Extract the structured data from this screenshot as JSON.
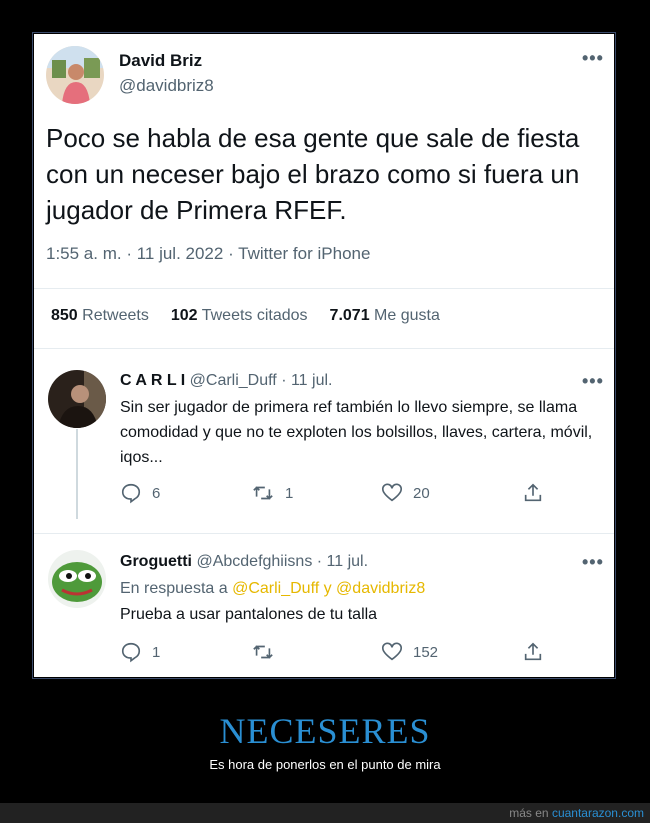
{
  "tweet": {
    "author_name": "David Briz",
    "author_handle": "@davidbriz8",
    "text": "Poco se habla de esa gente que sale de fiesta con un neceser bajo el brazo como si fuera un jugador de Primera RFEF.",
    "time": "1:55 a. m. · 11 jul. 2022 · Twitter for iPhone",
    "stats": {
      "retweets_count": "850",
      "retweets_label": "Retweets",
      "quotes_count": "102",
      "quotes_label": "Tweets citados",
      "likes_count": "7.071",
      "likes_label": "Me gusta"
    }
  },
  "replies": [
    {
      "name": "C A R L I",
      "handle": "@Carli_Duff",
      "date": "· 11 jul.",
      "text": "Sin ser jugador de primera ref también lo llevo siempre, se llama comodidad y que no te exploten los bolsillos, llaves, cartera, móvil, iqos...",
      "replies_count": "6",
      "retweets_count": "1",
      "likes_count": "20"
    },
    {
      "name": "Groguetti",
      "handle": "@Abcdefghiisns",
      "date": "· 11 jul.",
      "in_reply_prefix": "En respuesta a",
      "in_reply_to": "@Carli_Duff y @davidbriz8",
      "text": "Prueba a usar pantalones de tu talla",
      "replies_count": "1",
      "retweets_count": "",
      "likes_count": "152"
    }
  ],
  "caption": {
    "title": "NECESERES",
    "subtitle": "Es hora de ponerlos en el punto de mira"
  },
  "footer": {
    "prefix": "más en",
    "site": "cuantarazon.com"
  },
  "colors": {
    "accent": "#2a8fd3",
    "link": "#e6b800",
    "muted": "#536471"
  }
}
